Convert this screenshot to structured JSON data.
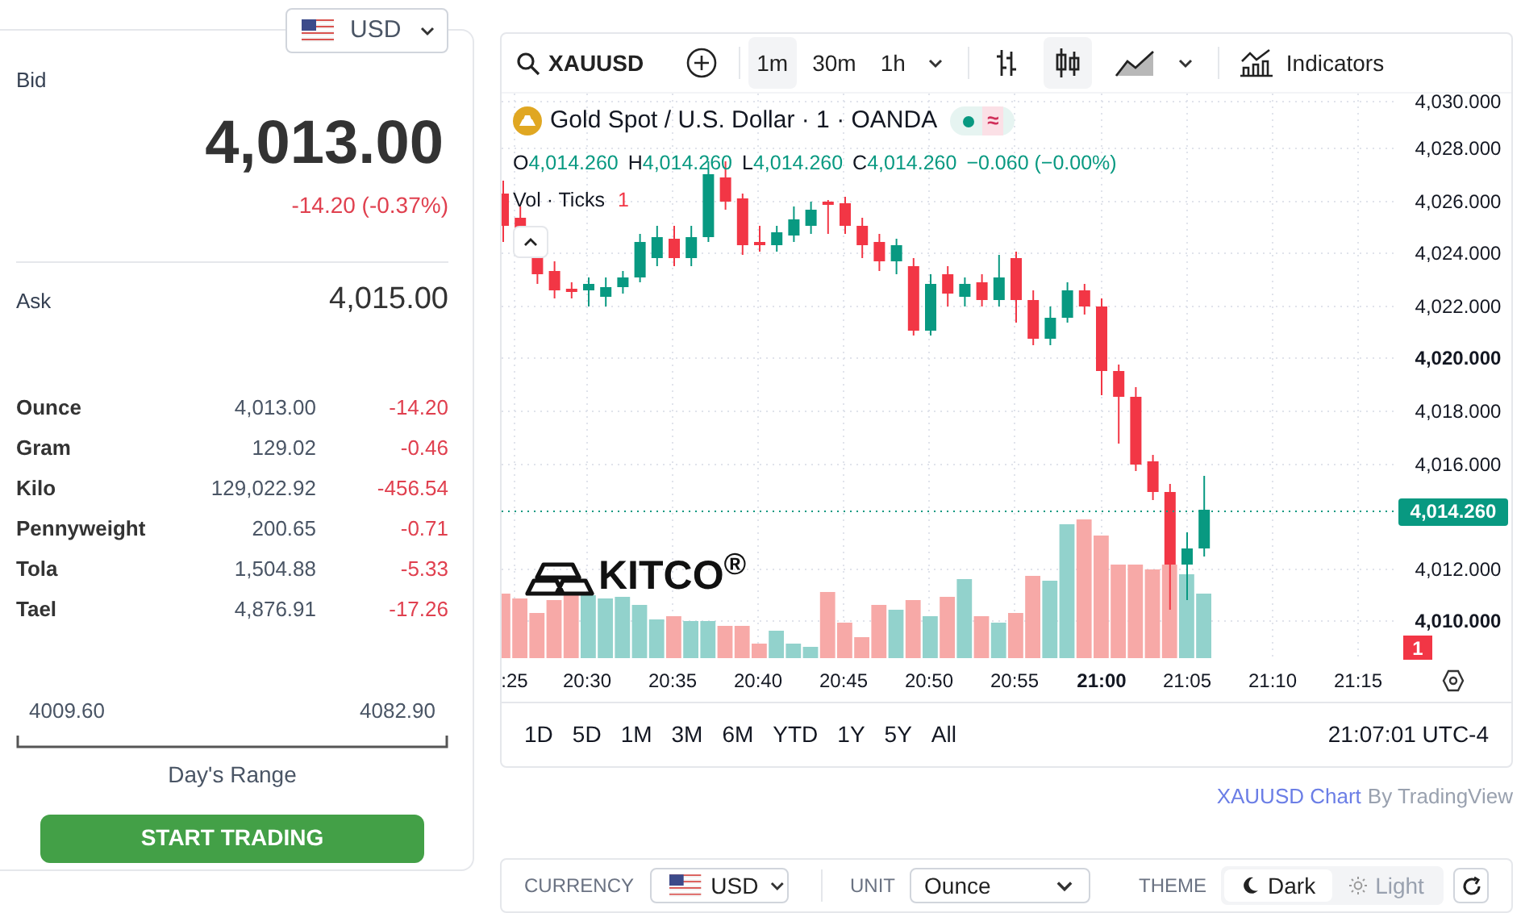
{
  "currency_selector": {
    "value": "USD"
  },
  "quote": {
    "bid_label": "Bid",
    "bid": "4,013.00",
    "change": "-14.20 (-0.37%)",
    "ask_label": "Ask",
    "ask": "4,015.00"
  },
  "units": [
    {
      "name": "Ounce",
      "price": "4,013.00",
      "change": "-14.20"
    },
    {
      "name": "Gram",
      "price": "129.02",
      "change": "-0.46"
    },
    {
      "name": "Kilo",
      "price": "129,022.92",
      "change": "-456.54"
    },
    {
      "name": "Pennyweight",
      "price": "200.65",
      "change": "-0.71"
    },
    {
      "name": "Tola",
      "price": "1,504.88",
      "change": "-5.33"
    },
    {
      "name": "Tael",
      "price": "4,876.91",
      "change": "-17.26"
    }
  ],
  "days_range": {
    "low": "4009.60",
    "high": "4082.90",
    "label": "Day's Range"
  },
  "start_button": "START TRADING",
  "chart": {
    "symbol": "XAUUSD",
    "intervals": [
      {
        "label": "1m",
        "selected": true
      },
      {
        "label": "30m",
        "selected": false
      },
      {
        "label": "1h",
        "selected": false
      }
    ],
    "chart_types": [
      {
        "kind": "bars",
        "selected": false
      },
      {
        "kind": "candles",
        "selected": true
      },
      {
        "kind": "area",
        "selected": false
      }
    ],
    "indicators": "Indicators",
    "legend": {
      "title": "Gold Spot / U.S. Dollar · 1 · OANDA",
      "status": "≈",
      "ohlc": [
        {
          "key": "O",
          "value": "4,014.260"
        },
        {
          "key": "H",
          "value": "4,014.260"
        },
        {
          "key": "L",
          "value": "4,014.260"
        },
        {
          "key": "C",
          "value": "4,014.260"
        }
      ],
      "change": "−0.060 (−0.00%)",
      "volume_label": "Vol · Ticks",
      "volume_value": "1"
    },
    "price_axis": [
      {
        "label": "4,030.000",
        "bold": false
      },
      {
        "label": "4,028.000",
        "bold": false
      },
      {
        "label": "4,026.000",
        "bold": false
      },
      {
        "label": "4,024.000",
        "bold": false
      },
      {
        "label": "4,022.000",
        "bold": false
      },
      {
        "label": "4,020.000",
        "bold": true
      },
      {
        "label": "4,018.000",
        "bold": false
      },
      {
        "label": "4,016.000",
        "bold": false
      },
      {
        "label": "4,012.000",
        "bold": false
      },
      {
        "label": "4,010.000",
        "bold": true
      }
    ],
    "last_price": "4,014.260",
    "volume_badge": "1",
    "time_axis": [
      {
        "label": ":25",
        "bold": false
      },
      {
        "label": "20:30",
        "bold": false
      },
      {
        "label": "20:35",
        "bold": false
      },
      {
        "label": "20:40",
        "bold": false
      },
      {
        "label": "20:45",
        "bold": false
      },
      {
        "label": "20:50",
        "bold": false
      },
      {
        "label": "20:55",
        "bold": false
      },
      {
        "label": "21:00",
        "bold": true
      },
      {
        "label": "21:05",
        "bold": false
      },
      {
        "label": "21:10",
        "bold": false
      },
      {
        "label": "21:15",
        "bold": false
      }
    ],
    "logo": "KITCO$^{®}$",
    "ranges": [
      "1D",
      "5D",
      "1M",
      "3M",
      "6M",
      "YTD",
      "1Y",
      "5Y",
      "All"
    ],
    "clock": "21:07:01 UTC-4"
  },
  "attribution": {
    "link": "XAUUSD Chart",
    "suffix": "By TradingView"
  },
  "settings": {
    "currency_label": "CURRENCY",
    "currency": "USD",
    "unit_label": "UNIT",
    "unit": "Ounce",
    "theme_label": "THEME",
    "themes": [
      {
        "kind": "dark",
        "label": "Dark",
        "selected": true
      },
      {
        "kind": "light",
        "label": "Light",
        "selected": false
      }
    ]
  }
}
